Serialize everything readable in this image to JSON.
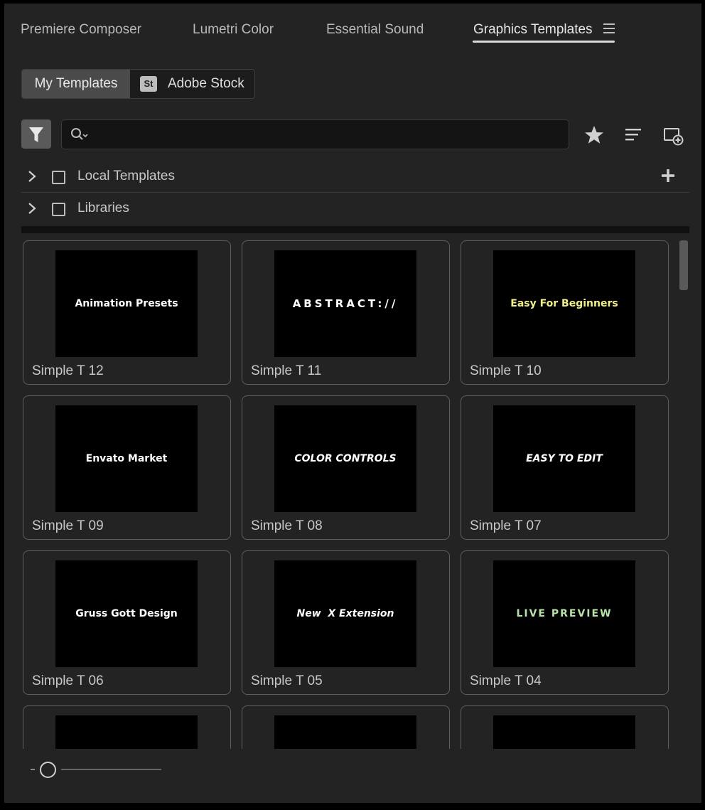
{
  "tabs": [
    {
      "label": "Premiere Composer"
    },
    {
      "label": "Lumetri Color"
    },
    {
      "label": "Essential Sound"
    },
    {
      "label": "Graphics Templates",
      "active": true
    }
  ],
  "source_toggle": {
    "my_templates": "My Templates",
    "stock_badge": "St",
    "adobe_stock": "Adobe Stock"
  },
  "search": {
    "value": "",
    "placeholder": ""
  },
  "tree": [
    {
      "label": "Local Templates",
      "checked": false
    },
    {
      "label": "Libraries",
      "checked": false
    }
  ],
  "templates": [
    {
      "name": "Simple T 12",
      "thumb_text": "Animation Presets",
      "thumb_color": "#ffffff"
    },
    {
      "name": "Simple T 11",
      "thumb_text": "ABSTRACT://",
      "thumb_color": "#ffffff"
    },
    {
      "name": "Simple T 10",
      "thumb_text": "Easy For Beginners",
      "thumb_color": "#f1f08a"
    },
    {
      "name": "Simple T 09",
      "thumb_text": "Envato Market",
      "thumb_color": "#ffffff"
    },
    {
      "name": "Simple T 08",
      "thumb_text": "COLOR CONTROLS",
      "thumb_color": "#ffffff"
    },
    {
      "name": "Simple T 07",
      "thumb_text": "EASY TO EDIT",
      "thumb_color": "#ffffff"
    },
    {
      "name": "Simple T 06",
      "thumb_text": "Gruss Gott Design",
      "thumb_color": "#ffffff"
    },
    {
      "name": "Simple T 05",
      "thumb_text": "New  X Extension",
      "thumb_color": "#ffffff"
    },
    {
      "name": "Simple T 04",
      "thumb_text": "LIVE PREVIEW",
      "thumb_color": "#b6e3a6"
    }
  ],
  "colors": {
    "panel": "#232323",
    "active_tab_underline": "#d8d8d8",
    "accent_yellow": "#f1f08a",
    "accent_green": "#b6e3a6"
  },
  "thumbnail_size_slider": {
    "level": 0.1
  }
}
